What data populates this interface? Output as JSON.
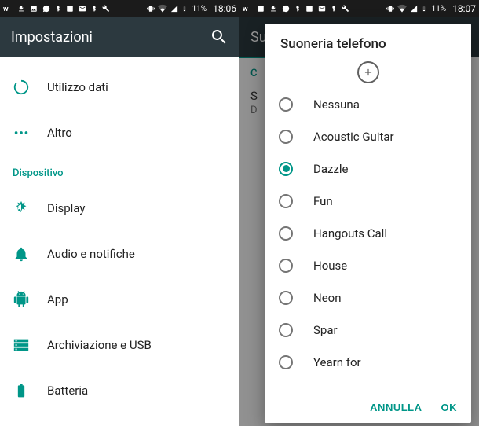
{
  "left": {
    "status": {
      "battery": "11%",
      "time": "18:06"
    },
    "appbar_title": "Impostazioni",
    "items_top": [
      {
        "id": "data-usage",
        "label": "Utilizzo dati",
        "icon": "data"
      },
      {
        "id": "more",
        "label": "Altro",
        "icon": "dots"
      }
    ],
    "section_label": "Dispositivo",
    "items_device": [
      {
        "id": "display",
        "label": "Display",
        "icon": "display"
      },
      {
        "id": "sound",
        "label": "Audio e notifiche",
        "icon": "bell"
      },
      {
        "id": "apps",
        "label": "App",
        "icon": "android"
      },
      {
        "id": "storage",
        "label": "Archiviazione e USB",
        "icon": "storage"
      },
      {
        "id": "battery",
        "label": "Batteria",
        "icon": "battery"
      }
    ]
  },
  "right": {
    "status": {
      "battery": "11%",
      "time": "18:07"
    },
    "bg_title_prefix": "Su",
    "bg_c": "C",
    "bg_s": "S",
    "bg_d": "D",
    "dialog": {
      "title": "Suoneria telefono",
      "options": [
        {
          "label": "Nessuna",
          "selected": false
        },
        {
          "label": "Acoustic Guitar",
          "selected": false
        },
        {
          "label": "Dazzle",
          "selected": true
        },
        {
          "label": "Fun",
          "selected": false
        },
        {
          "label": "Hangouts Call",
          "selected": false
        },
        {
          "label": "House",
          "selected": false
        },
        {
          "label": "Neon",
          "selected": false
        },
        {
          "label": "Spar",
          "selected": false
        },
        {
          "label": "Yearn for",
          "selected": false
        }
      ],
      "cancel": "ANNULLA",
      "ok": "OK"
    }
  }
}
